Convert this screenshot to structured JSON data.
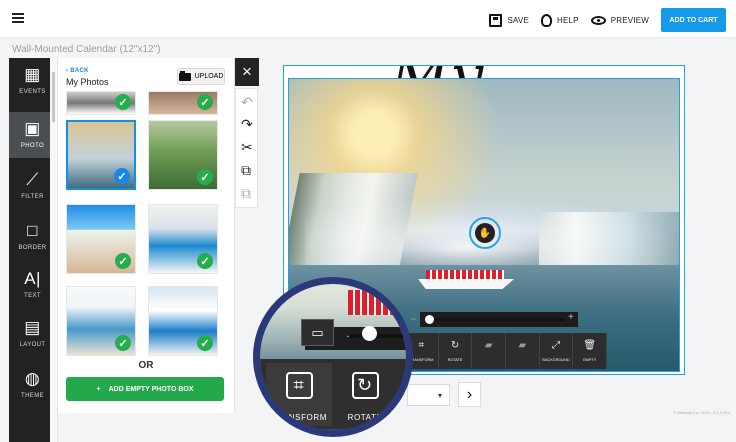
{
  "topbar": {
    "save": "SAVE",
    "help": "HELP",
    "preview": "PREVIEW",
    "cart": "ADD TO CART",
    "accent": "#1699E6"
  },
  "product": {
    "title": "Wall-Mounted Calendar (12\"x12\")"
  },
  "sidebar": {
    "items": [
      {
        "label": "EVENTS",
        "icon": "calendar-icon"
      },
      {
        "label": "PHOTO",
        "icon": "image-icon"
      },
      {
        "label": "FILTER",
        "icon": "magic-wand-icon"
      },
      {
        "label": "BORDER",
        "icon": "border-icon"
      },
      {
        "label": "TEXT",
        "icon": "text-icon"
      },
      {
        "label": "LAYOUT",
        "icon": "layout-icon"
      },
      {
        "label": "THEME",
        "icon": "palette-icon"
      }
    ]
  },
  "panel": {
    "back": "BACK",
    "title": "My Photos",
    "upload": "UPLOAD",
    "or": "OR",
    "add_empty": "ADD EMPTY PHOTO BOX",
    "success_color": "#23A84C"
  },
  "canvas": {
    "script_title": "My Calendar"
  },
  "toolbar": {
    "small": [
      "TRANSFORM",
      "ROTATE",
      "",
      "",
      "BACKGROUND",
      "EMPTY"
    ],
    "magnified": [
      "TRANSFORM",
      "ROTATE"
    ]
  },
  "footer": {
    "copyright": "© Mixbook Inc. 2018 - 8.1.0 914"
  }
}
